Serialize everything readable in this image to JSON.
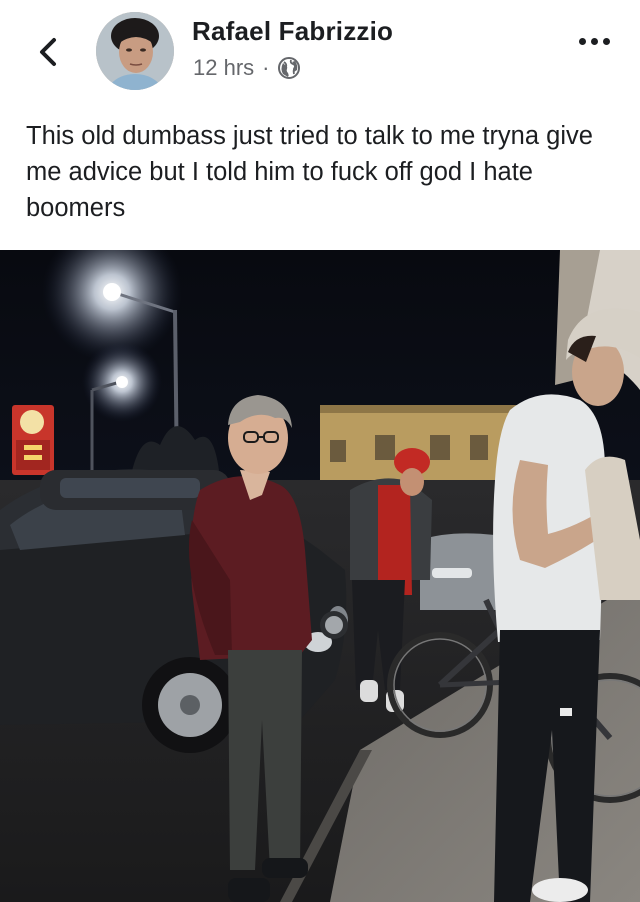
{
  "header": {
    "back_icon": "chevron-left-icon",
    "author_name": "Rafael Fabrizzio",
    "timestamp": "12 hrs",
    "separator": "·",
    "privacy_icon": "globe-icon",
    "more_icon": "more-horizontal-icon"
  },
  "post": {
    "text": "This old dumbass just tried to talk to me tryna give me advice but I told him to fuck off god I hate boomers"
  },
  "photo": {
    "description_icon": "post-photo"
  },
  "colors": {
    "name_text": "#1c1e21",
    "meta_text": "#65676b",
    "background": "#ffffff"
  }
}
